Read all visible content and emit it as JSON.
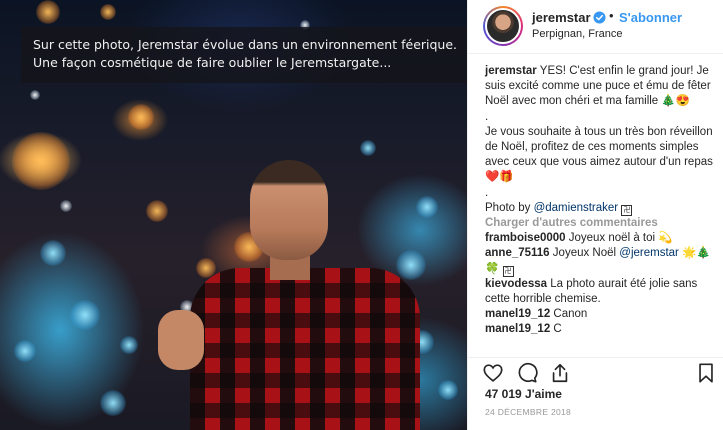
{
  "photo": {
    "overlay_line1": "Sur cette photo, Jeremstar évolue dans un environnement féerique.",
    "overlay_line2": "Une façon cosmétique de faire oublier le Jeremstargate..."
  },
  "header": {
    "username": "jeremstar",
    "separator": "•",
    "follow_label": "S'abonner",
    "location": "Perpignan, France"
  },
  "caption": {
    "username": "jeremstar",
    "text1": "YES! C'est enfin le grand jour! Je suis excité comme une puce et ému de fêter Noël avec mon chéri et ma famille 🎄😍",
    "dot1": ".",
    "text2": "Je vous souhaite à tous un très bon réveillon de Noël, profitez de ces moments simples avec ceux que vous aimez autour d'un repas ❤️🎁",
    "dot2": ".",
    "photo_by_prefix": "Photo by ",
    "photo_by_handle": "@damienstraker",
    "photo_by_chip": "卍"
  },
  "load_more": "Charger d'autres commentaires",
  "comments": [
    {
      "user": "framboise0000",
      "text": "Joyeux noël à toi 💫"
    },
    {
      "user": "anne_75116",
      "text": "Joyeux Noël ",
      "mention": "@jeremstar",
      "emoji": "🌟🎄🍀",
      "chip": "卍"
    },
    {
      "user": "kievodessa",
      "text": "La photo aurait été jolie sans cette horrible chemise."
    },
    {
      "user": "manel19_12",
      "text": "Canon"
    },
    {
      "user": "manel19_12",
      "text": "C"
    }
  ],
  "actions": {
    "like_icon": "heart-icon",
    "comment_icon": "comment-icon",
    "share_icon": "share-icon",
    "save_icon": "bookmark-icon"
  },
  "likes": "47 019 J'aime",
  "date": "24 DÉCEMBRE 2018",
  "colors": {
    "accent": "#3897f0",
    "verified": "#3897f0",
    "text": "#262626",
    "muted": "#999999",
    "overlay_bg": "#141419"
  }
}
